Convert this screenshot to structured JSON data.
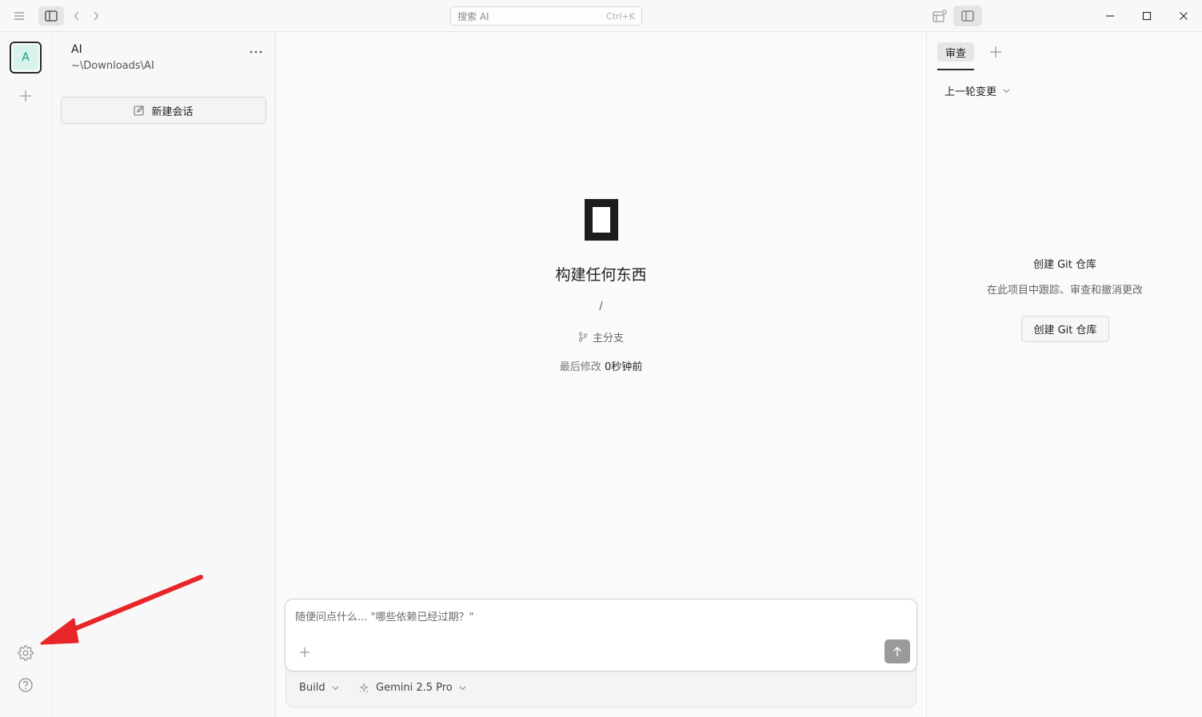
{
  "titlebar": {
    "search_placeholder": "搜索 AI",
    "search_shortcut": "Ctrl+K"
  },
  "rail": {
    "project_initial": "A"
  },
  "sidebar": {
    "project_name": "AI",
    "project_path": "~\\Downloads\\AI",
    "new_session_label": "新建会话"
  },
  "main": {
    "title": "构建任何东西",
    "path": "/",
    "branch": "主分支",
    "modified_label": "最后修改",
    "modified_value": "0秒钟前"
  },
  "composer": {
    "placeholder": "随便问点什么... \"哪些依赖已经过期？\"",
    "mode": "Build",
    "model": "Gemini 2.5 Pro"
  },
  "right_panel": {
    "tab_label": "审查",
    "changes_select": "上一轮变更",
    "git_title": "创建 Git 仓库",
    "git_desc": "在此项目中跟踪、审查和撤消更改",
    "git_button": "创建 Git 仓库"
  },
  "colors": {
    "accent_avatar_bg": "#d8f3ec",
    "accent_avatar_fg": "#1a9a7a",
    "annotation_arrow": "#e8262a"
  },
  "icons": [
    "menu-icon",
    "sidebar-toggle-icon",
    "chevron-left-icon",
    "chevron-right-icon",
    "layout-icon",
    "panel-toggle-icon",
    "minimize-icon",
    "maximize-icon",
    "close-icon",
    "plus-icon",
    "settings-gear-icon",
    "help-icon",
    "more-icon",
    "edit-icon",
    "branch-icon",
    "arrow-up-icon",
    "sparkle-icon",
    "chevron-down-icon"
  ]
}
